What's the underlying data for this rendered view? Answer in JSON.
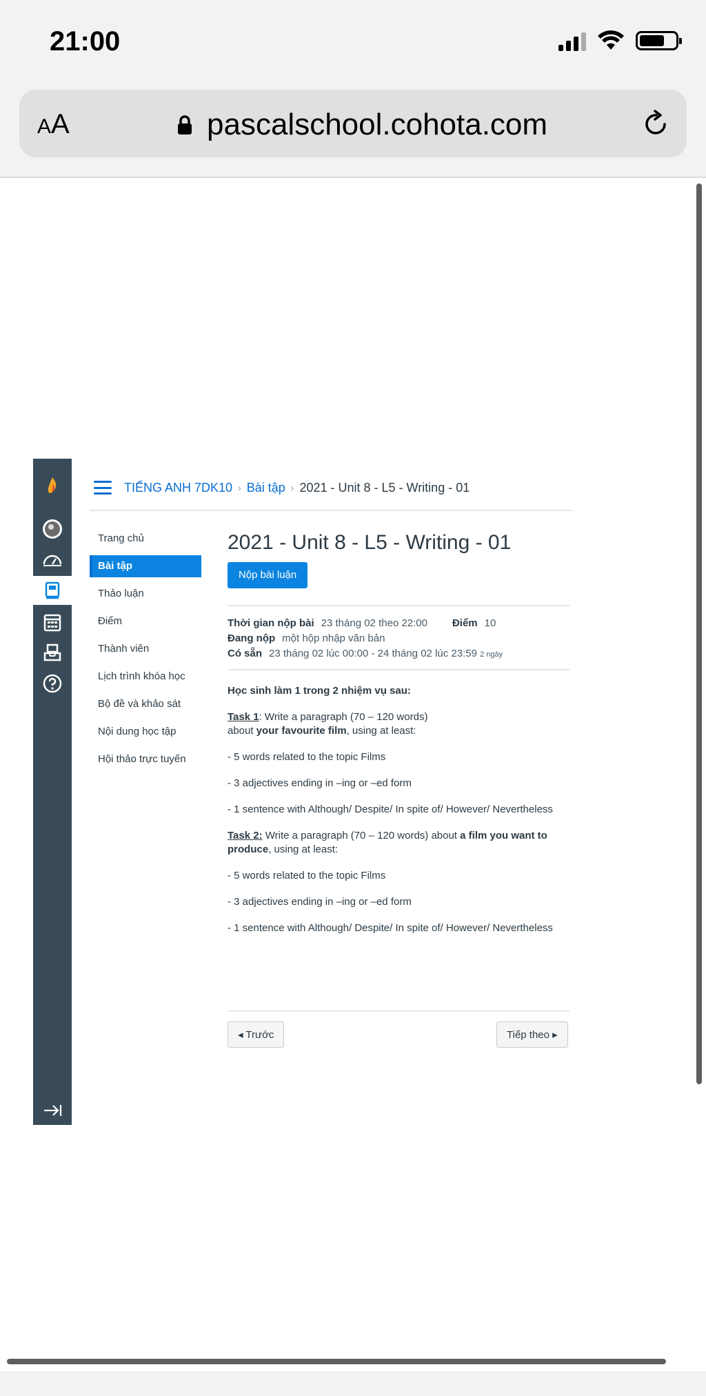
{
  "status_bar": {
    "time": "21:00"
  },
  "browser": {
    "aa_label_big": "A",
    "aa_label_small": "A",
    "url": "pascalschool.cohota.com"
  },
  "breadcrumb": {
    "course": "TIẾNG ANH 7DK10",
    "section": "Bài tập",
    "current": "2021 - Unit 8 - L5 - Writing - 01"
  },
  "course_nav": [
    {
      "label": "Trang chủ",
      "active": false
    },
    {
      "label": "Bài tập",
      "active": true
    },
    {
      "label": "Thảo luận",
      "active": false
    },
    {
      "label": "Điểm",
      "active": false
    },
    {
      "label": "Thành viên",
      "active": false
    },
    {
      "label": "Lịch trình khóa học",
      "active": false
    },
    {
      "label": "Bộ đề và khảo sát",
      "active": false
    },
    {
      "label": "Nội dung học tập",
      "active": false
    },
    {
      "label": "Hội thảo trực tuyến",
      "active": false
    }
  ],
  "assignment": {
    "title": "2021 - Unit 8 - L5 - Writing - 01",
    "submit_label": "Nộp bài luận",
    "due_label": "Thời gian nộp bài",
    "due_value": "23 tháng 02 theo 22:00",
    "points_label": "Điểm",
    "points_value": "10",
    "submitting_label": "Đang nộp",
    "submitting_value": "một hộp nhập văn bản",
    "available_label": "Có sẵn",
    "available_value": "23 tháng 02 lúc 00:00 - 24 tháng 02 lúc 23:59",
    "available_note": "2 ngày",
    "intro": "Học sinh làm 1 trong 2 nhiệm vụ sau:",
    "task1_label": "Task 1",
    "task1_text_a": ": Write a paragraph (70 – 120 words)",
    "task1_text_b": "about ",
    "task1_bold": "your favourite film",
    "task1_text_c": ", using at least:",
    "task1_items": [
      "- 5 words related to the topic Films",
      "- 3 adjectives ending in –ing or –ed form",
      "- 1 sentence with Although/ Despite/ In spite of/ However/ Nevertheless"
    ],
    "task2_label": "Task 2:",
    "task2_text_a": " Write a paragraph (70 – 120 words) about ",
    "task2_bold": "a film you want to produce",
    "task2_text_b": ", using at least:",
    "task2_items": [
      "- 5 words related to the topic Films",
      "- 3 adjectives ending in –ing or –ed form",
      "- 1 sentence with Although/ Despite/ In spite of/ However/ Nevertheless"
    ]
  },
  "pager": {
    "prev": "◂ Trước",
    "next": "Tiếp theo ▸"
  },
  "colors": {
    "nav_bg": "#394b58",
    "accent": "#0a84e0",
    "link": "#0a6ed1"
  }
}
